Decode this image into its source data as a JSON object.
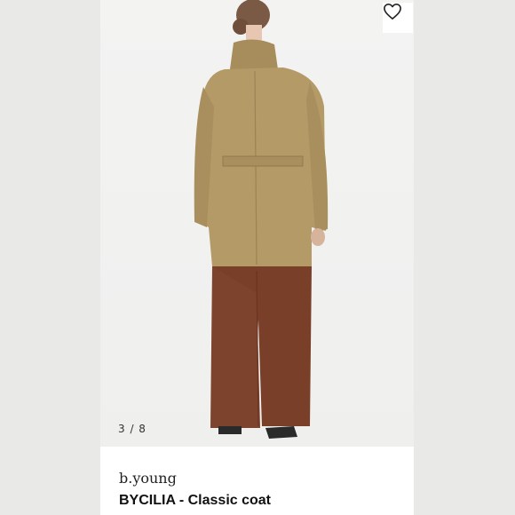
{
  "product": {
    "brand": "b.young",
    "title": "BYCILIA - Classic coat",
    "image_counter": "3 / 8"
  },
  "icons": {
    "favorite": "heart-outline-icon"
  },
  "colors": {
    "coat": "#b49a67",
    "trousers": "#7a3f28",
    "background": "#f1f1f0"
  }
}
